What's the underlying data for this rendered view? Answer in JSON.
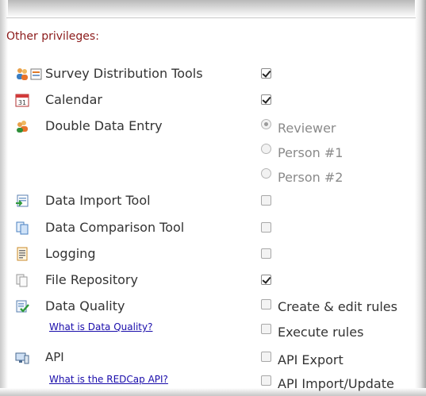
{
  "section": {
    "title": "Other privileges:"
  },
  "rows": [
    {
      "label": "Survey Distribution Tools",
      "checked": true,
      "icon": "users-icon"
    },
    {
      "label": "Calendar",
      "checked": true,
      "icon": "calendar-icon"
    },
    {
      "label": "Double Data Entry",
      "icon": "user-pair-icon"
    },
    {
      "label": "Data Import Tool",
      "checked": false,
      "icon": "import-icon"
    },
    {
      "label": "Data Comparison Tool",
      "checked": false,
      "icon": "compare-icon"
    },
    {
      "label": "Logging",
      "checked": false,
      "icon": "log-icon"
    },
    {
      "label": "File Repository",
      "checked": true,
      "icon": "files-icon"
    },
    {
      "label": "Data Quality",
      "icon": "quality-check-icon"
    },
    {
      "label": "API",
      "icon": "api-icon"
    }
  ],
  "double_data_entry": {
    "options": [
      "Reviewer",
      "Person #1",
      "Person #2"
    ],
    "selected": "Reviewer"
  },
  "calendar_icon_text": "31",
  "data_quality": {
    "help_link": "What is Data Quality?",
    "options": [
      {
        "label": "Create & edit rules",
        "checked": false
      },
      {
        "label": "Execute rules",
        "checked": false
      }
    ]
  },
  "api": {
    "help_link": "What is the REDCap API?",
    "options": [
      {
        "label": "API Export",
        "checked": false
      },
      {
        "label": "API Import/Update",
        "checked": false
      }
    ]
  }
}
